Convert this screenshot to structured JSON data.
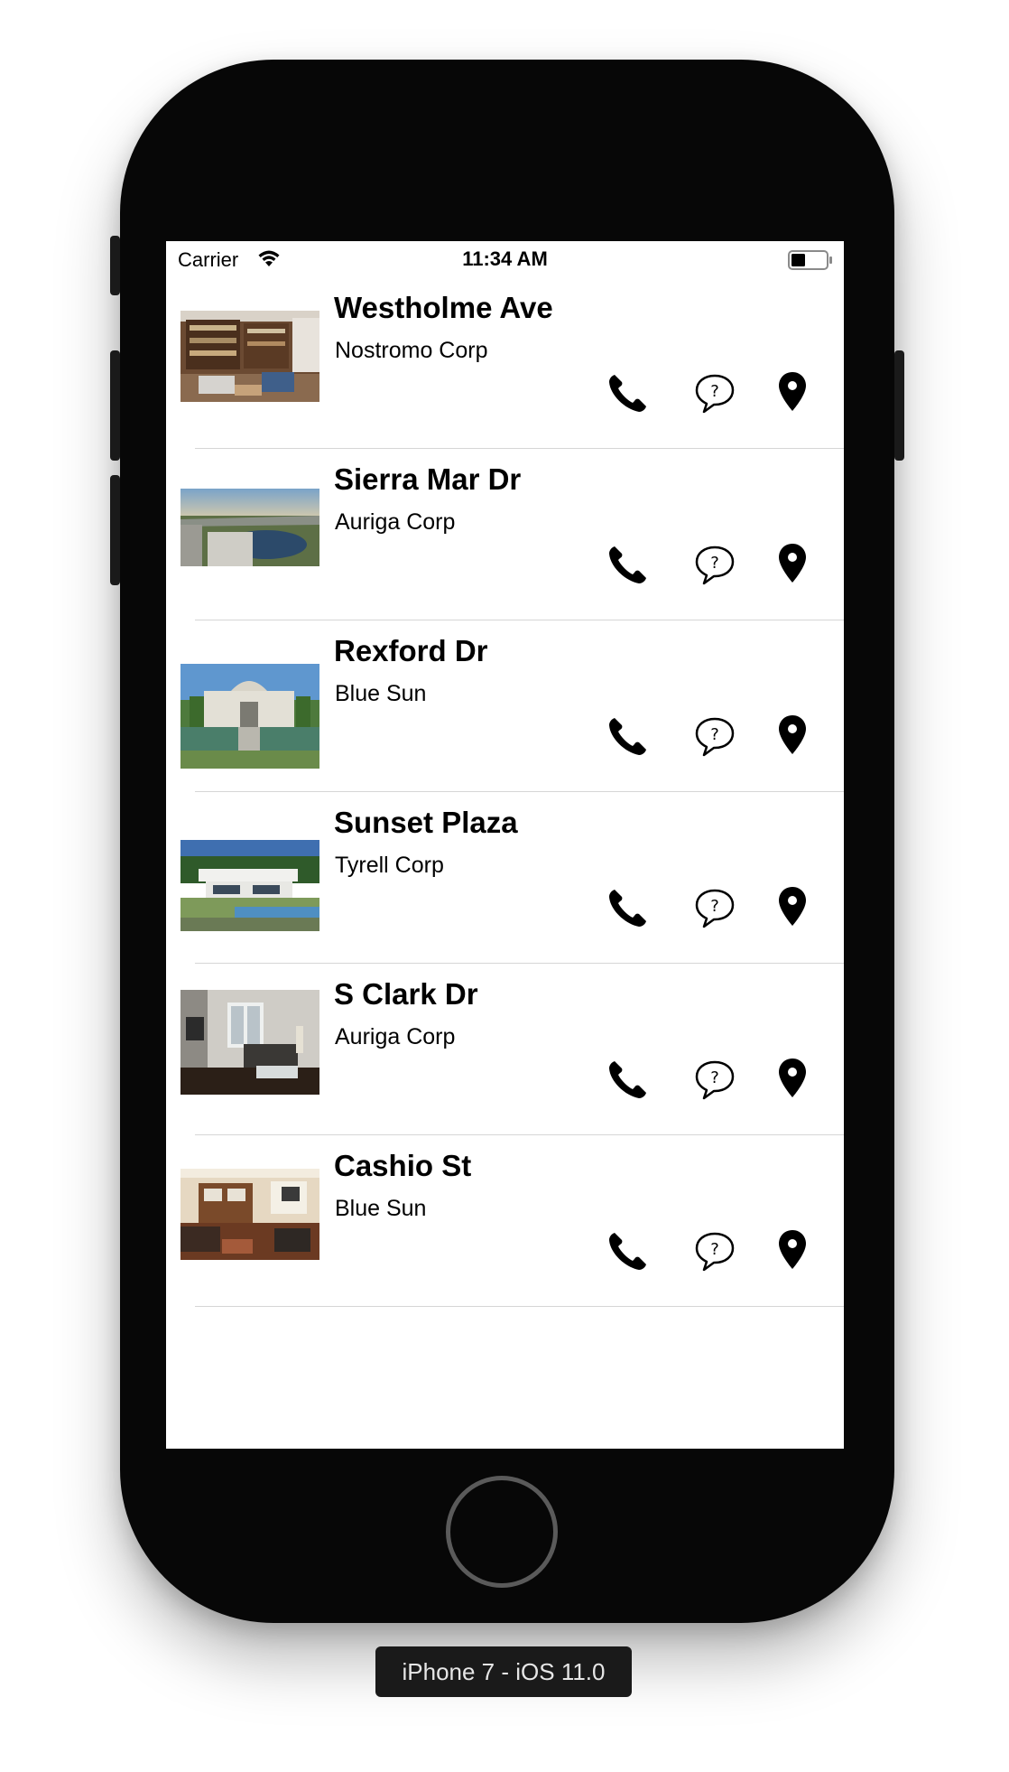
{
  "status_bar": {
    "carrier": "Carrier",
    "time": "11:34 AM",
    "battery_level": 0.4
  },
  "listings": [
    {
      "title": "Westholme Ave",
      "company": "Nostromo Corp",
      "image": "library-interior"
    },
    {
      "title": "Sierra Mar Dr",
      "company": "Auriga Corp",
      "image": "hillside-view"
    },
    {
      "title": "Rexford Dr",
      "company": "Blue Sun",
      "image": "mansion-facade"
    },
    {
      "title": "Sunset Plaza",
      "company": "Tyrell Corp",
      "image": "modern-villa"
    },
    {
      "title": "S Clark Dr",
      "company": "Auriga Corp",
      "image": "living-room"
    },
    {
      "title": "Cashio St",
      "company": "Blue Sun",
      "image": "open-plan-interior"
    }
  ],
  "row_actions": [
    "phone-icon",
    "question-bubble-icon",
    "map-pin-icon"
  ],
  "device_label": "iPhone 7 - iOS 11.0"
}
